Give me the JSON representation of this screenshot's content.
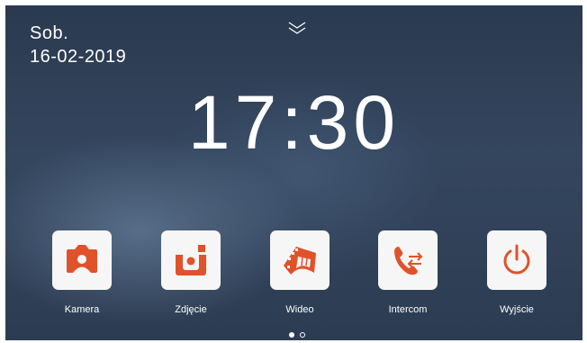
{
  "header": {
    "day": "Sob.",
    "date": "16-02-2019"
  },
  "clock": {
    "time": "17:30"
  },
  "apps": [
    {
      "label": "Kamera",
      "icon": "camera-icon"
    },
    {
      "label": "Zdjęcie",
      "icon": "photo-icon"
    },
    {
      "label": "Wideo",
      "icon": "film-icon"
    },
    {
      "label": "Intercom",
      "icon": "intercom-icon"
    },
    {
      "label": "Wyjście",
      "icon": "power-icon"
    }
  ],
  "pagination": {
    "current": 1,
    "total": 2
  },
  "colors": {
    "accent": "#e0522a",
    "tile": "#f6f6f6",
    "text": "#ffffff"
  }
}
